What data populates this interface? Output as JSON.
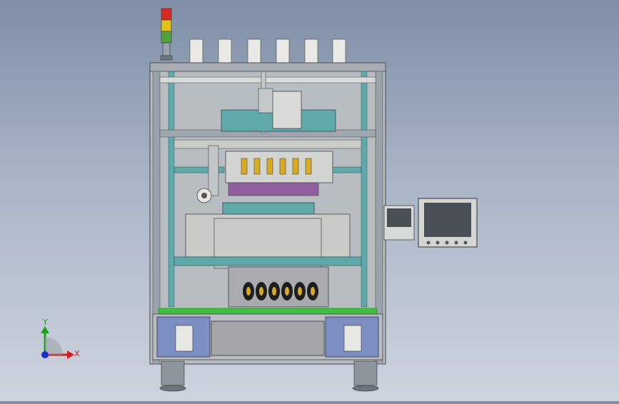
{
  "viewport": {
    "triad": {
      "y_label": "Y",
      "x_label": "X"
    },
    "colors": {
      "frame": "#8e9ba8",
      "teal": "#5fa9a8",
      "blue_panel": "#7c8ec2",
      "green_strip": "#3fbf3f",
      "light_panel": "#c9cbc6",
      "screen_dark": "#4a4f55"
    }
  }
}
